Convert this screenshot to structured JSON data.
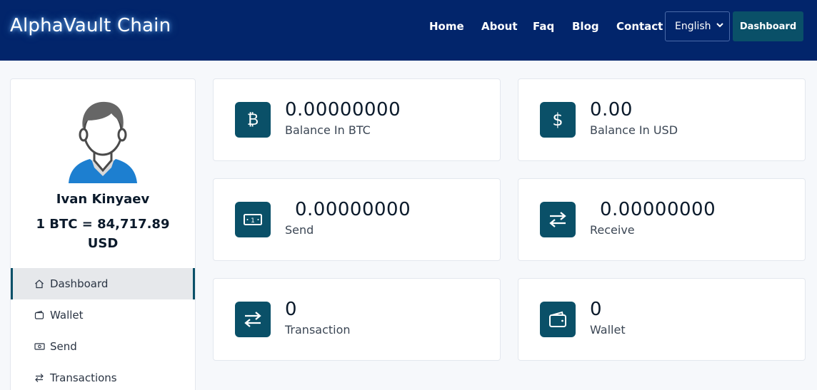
{
  "header": {
    "brand": "AlphaVault Chain",
    "nav": [
      "Home",
      "About",
      "Faq",
      "Blog",
      "Contact"
    ],
    "language": "English",
    "dashboard_button": "Dashboard"
  },
  "sidebar": {
    "user_name": "Ivan Kinyaev",
    "rate_line1": "1 BTC = 84,717.89",
    "rate_line2": "USD",
    "menu": [
      {
        "label": "Dashboard",
        "icon": "home-icon"
      },
      {
        "label": "Wallet",
        "icon": "wallet-icon"
      },
      {
        "label": "Send",
        "icon": "banknote-icon"
      },
      {
        "label": "Transactions",
        "icon": "arrows-swap-icon"
      }
    ]
  },
  "cards": [
    {
      "value": "0.00000000",
      "label": "Balance In BTC",
      "icon": "bitcoin-icon"
    },
    {
      "value": "0.00",
      "label": "Balance In USD",
      "icon": "dollar-icon"
    },
    {
      "value": "0.00000000",
      "label": "Send",
      "icon": "banknote-icon"
    },
    {
      "value": "0.00000000",
      "label": "Receive",
      "icon": "arrows-swap-icon"
    },
    {
      "value": "0",
      "label": "Transaction",
      "icon": "arrows-swap-icon"
    },
    {
      "value": "0",
      "label": "Wallet",
      "icon": "wallet-icon"
    }
  ],
  "colors": {
    "header_bg": "#02256b",
    "accent": "#0a5068",
    "avatar_blue": "#1d7fd0"
  }
}
